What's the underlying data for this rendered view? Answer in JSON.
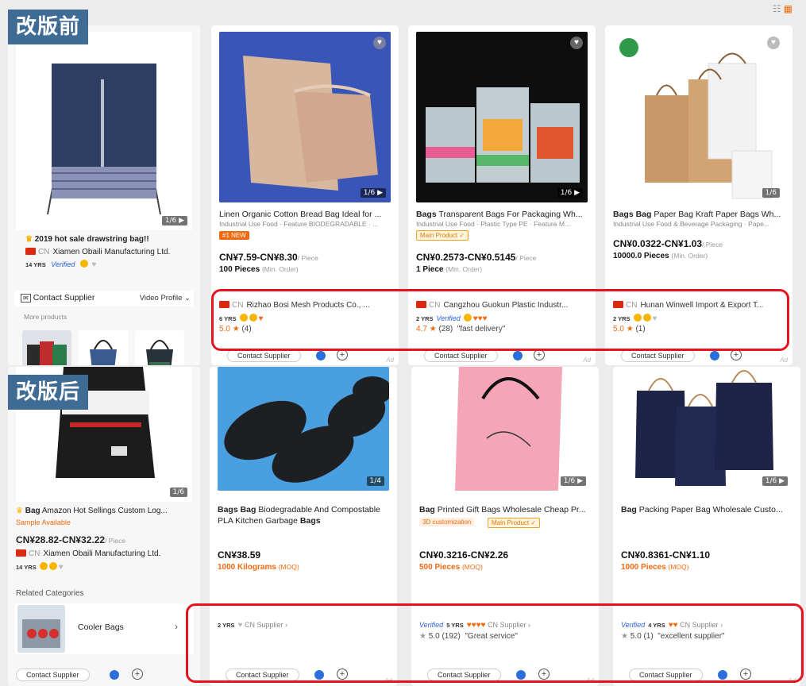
{
  "labels": {
    "before": "改版前",
    "after": "改版后"
  },
  "view_icons": {
    "list": "☷",
    "grid": "▦"
  },
  "top": {
    "side": {
      "counter": "1/6 ▶",
      "title_prefix": "2019 hot sale drawstring bag!!",
      "supplier_cn": "CN",
      "supplier_name": "Xiamen Obaili Manufacturing Ltd.",
      "yrs": "14 YRS",
      "verified": "Verified",
      "contact": "Contact Supplier",
      "video": "Video Profile ⌄",
      "more_products": "More products"
    },
    "cards": [
      {
        "counter": "1/6 ▶",
        "title_bold": "",
        "title": "Linen Organic Cotton Bread Bag Ideal for ...",
        "sub": "Industrial Use Food · Feature BIODEGRADABLE · ...",
        "tag": "#1 NEW",
        "price": "CN¥7.59-CN¥8.30",
        "unit": "/ Piece",
        "moq": "100 Pieces",
        "moq_muted": "(Min. Order)",
        "cn": "CN",
        "supplier": "Rizhao Bosi Mesh Products Co., ...",
        "yrs": "6 YRS",
        "verified": "",
        "score": "5.0",
        "reviews": "(4)",
        "quote": "",
        "contact": "Contact Supplier",
        "ad": "Ad"
      },
      {
        "counter": "1/6 ▶",
        "title_bold": "Bags",
        "title": "Transparent Bags For Packaging Wh...",
        "sub": "Industrial Use Food · Plastic Type PE · Feature M...",
        "tag": "Main Product ✓",
        "price": "CN¥0.2573-CN¥0.5145",
        "unit": "/ Piece",
        "moq": "1 Piece",
        "moq_muted": "(Min. Order)",
        "cn": "CN",
        "supplier": "Cangzhou Guokun Plastic Industr...",
        "yrs": "2 YRS",
        "verified": "Verified",
        "score": "4.7",
        "reviews": "(28)",
        "quote": "\"fast delivery\"",
        "contact": "Contact Supplier",
        "ad": "Ad"
      },
      {
        "counter": "1/6",
        "title_bold": "Bags Bag",
        "title": "Paper Bag Kraft Paper Bags Wh...",
        "sub": "Industrial Use Food & Beverage Packaging · Pape...",
        "tag": "",
        "price": "CN¥0.0322-CN¥1.03",
        "unit": "/ Piece",
        "moq": "10000.0 Pieces",
        "moq_muted": "(Min. Order)",
        "cn": "CN",
        "supplier": "Hunan Winwell Import & Export T...",
        "yrs": "2 YRS",
        "verified": "",
        "score": "5.0",
        "reviews": "(1)",
        "quote": "",
        "contact": "Contact Supplier",
        "ad": "Ad"
      }
    ]
  },
  "bottom": {
    "side": {
      "counter": "1/6",
      "title_bold": "Bag",
      "title": "Amazon Hot Sellings Custom Log...",
      "tag": "Sample Available",
      "price": "CN¥28.82-CN¥32.22",
      "unit": "/ Piece",
      "cn": "CN",
      "supplier": "Xiamen Obaili Manufacturing Ltd.",
      "yrs": "14 YRS",
      "related": "Related Categories",
      "category": "Cooler Bags",
      "contact": "Contact Supplier"
    },
    "cards": [
      {
        "counter": "1/4",
        "title_bold": "Bags Bag",
        "title": "Biodegradable And Compostable",
        "title2_prefix": "PLA Kitchen Garbage ",
        "title2_bold": "Bags",
        "tag": "",
        "tag2": "",
        "price": "CN¥38.59",
        "moq": "1000 Kilograms",
        "moq_muted": "(MOQ)",
        "verified": "",
        "yrs": "2 YRS",
        "supplier_tag": "CN Supplier ›",
        "score": "",
        "reviews": "",
        "quote": "",
        "contact": "Contact Supplier",
        "ad": "Ad"
      },
      {
        "counter": "1/6 ▶",
        "title_bold": "Bag",
        "title": "Printed Gift Bags Wholesale Cheap Pr...",
        "title2_prefix": "",
        "title2_bold": "",
        "tag": "3D customization",
        "tag2": "Main Product ✓",
        "price": "CN¥0.3216-CN¥2.26",
        "moq": "500 Pieces",
        "moq_muted": "(MOQ)",
        "verified": "Verified",
        "yrs": "5 YRS",
        "supplier_tag": "CN Supplier ›",
        "score": "5.0",
        "reviews": "(192)",
        "quote": "\"Great service\"",
        "contact": "Contact Supplier",
        "ad": "Ad"
      },
      {
        "counter": "1/6 ▶",
        "title_bold": "Bag",
        "title": "Packing Paper Bag Wholesale Custo...",
        "title2_prefix": "",
        "title2_bold": "",
        "tag": "",
        "tag2": "",
        "price": "CN¥0.8361-CN¥1.10",
        "moq": "1000 Pieces",
        "moq_muted": "(MOQ)",
        "verified": "Verified",
        "yrs": "4 YRS",
        "supplier_tag": "CN Supplier ›",
        "score": "5.0",
        "reviews": "(1)",
        "quote": "\"excellent supplier\"",
        "contact": "Contact Supplier",
        "ad": "Ad"
      }
    ]
  },
  "colors": {
    "label_bg": "#3e6c95",
    "highlight": "#e8121d",
    "accent": "#f26a10",
    "verified": "#2a62e0"
  }
}
